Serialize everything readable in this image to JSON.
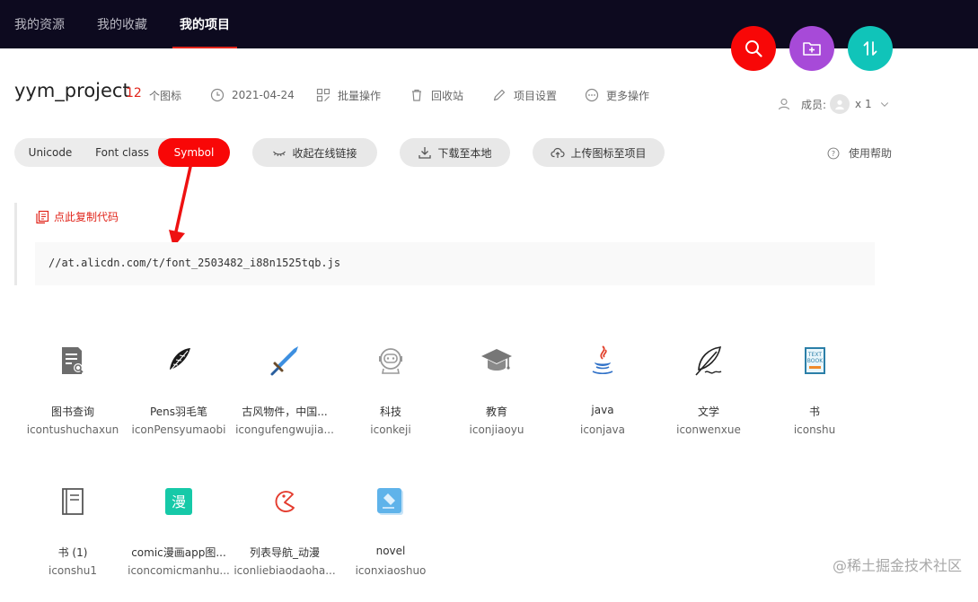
{
  "nav": {
    "tabs": [
      "我的资源",
      "我的收藏",
      "我的项目"
    ],
    "active_index": 2
  },
  "fabs": [
    {
      "icon": "search-icon",
      "color": "#f80707"
    },
    {
      "icon": "folder-add-icon",
      "color": "#a74ad8"
    },
    {
      "icon": "sort-icon",
      "color": "#10c4b9"
    }
  ],
  "project": {
    "name": "yym_project",
    "icon_count": "12",
    "icon_count_unit": "个图标",
    "date": "2021-04-24",
    "batch_ops": "批量操作",
    "recycle": "回收站",
    "settings": "项目设置",
    "more": "更多操作",
    "members_label": "成员:",
    "members_count": "x 1"
  },
  "toolbar": {
    "modes": [
      "Unicode",
      "Font class",
      "Symbol"
    ],
    "active_mode": 2,
    "collapse_link": "收起在线链接",
    "download": "下载至本地",
    "upload": "上传图标至项目",
    "help": "使用帮助"
  },
  "code": {
    "copy_label": "点此复制代码",
    "url": "//at.alicdn.com/t/font_2503482_i88n1525tqb.js"
  },
  "icons": [
    {
      "name": "图书查询",
      "class": "icontushuchaxun",
      "icon": "book-search-icon"
    },
    {
      "name": "Pens羽毛笔",
      "class": "iconPensyumaobi",
      "icon": "feather-pen-icon"
    },
    {
      "name": "古风物件，中国...",
      "class": "icongufengwujia...",
      "icon": "sword-icon"
    },
    {
      "name": "科技",
      "class": "iconkeji",
      "icon": "astronaut-icon"
    },
    {
      "name": "教育",
      "class": "iconjiaoyu",
      "icon": "graduation-cap-icon"
    },
    {
      "name": "java",
      "class": "iconjava",
      "icon": "java-icon"
    },
    {
      "name": "文学",
      "class": "iconwenxue",
      "icon": "quill-icon"
    },
    {
      "name": "书",
      "class": "iconshu",
      "icon": "textbook-icon"
    },
    {
      "name": "书 (1)",
      "class": "iconshu1",
      "icon": "book-icon"
    },
    {
      "name": "comic漫画app图...",
      "class": "iconcomicmanhu...",
      "icon": "comic-icon"
    },
    {
      "name": "列表导航_动漫",
      "class": "iconliebiaodaoha...",
      "icon": "pacman-icon"
    },
    {
      "name": "novel",
      "class": "iconxiaoshuo",
      "icon": "novel-icon"
    }
  ],
  "watermark": "@稀土掘金技术社区",
  "colors": {
    "nav_bg": "#0d0a1f",
    "accent": "#e1251b",
    "segment_active": "#f80707"
  }
}
